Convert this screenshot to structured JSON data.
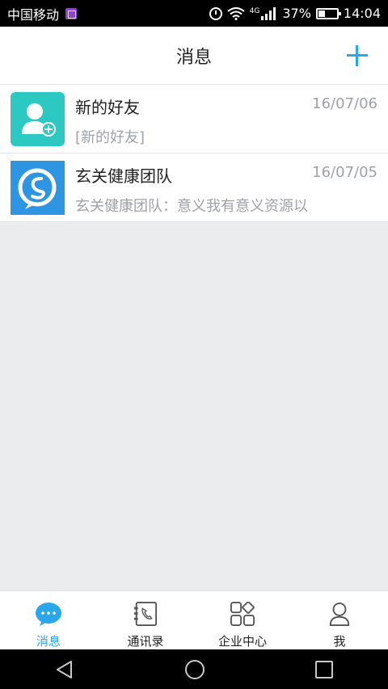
{
  "status_bar": {
    "carrier": "中国移动",
    "network": "4G",
    "battery_percent": "37%",
    "battery_level": 0.37,
    "time": "14:04"
  },
  "header": {
    "title": "消息"
  },
  "messages": [
    {
      "title": "新的好友",
      "preview": "[新的好友]",
      "date": "16/07/06",
      "avatar_icon": "add-friend-icon",
      "avatar_color": "#2cc9c3"
    },
    {
      "title": "玄关健康团队",
      "preview": "玄关健康团队：意义我有意义资源以",
      "date": "16/07/05",
      "avatar_icon": "team-logo-icon",
      "avatar_color": "#2d95e1"
    }
  ],
  "tabs": [
    {
      "label": "消息",
      "icon": "chat-bubble-icon",
      "active": true
    },
    {
      "label": "通讯录",
      "icon": "contacts-book-icon",
      "active": false
    },
    {
      "label": "企业中心",
      "icon": "enterprise-grid-icon",
      "active": false
    },
    {
      "label": "我",
      "icon": "profile-icon",
      "active": false
    }
  ],
  "colors": {
    "accent": "#2aa7e9",
    "background": "#ebeced"
  }
}
